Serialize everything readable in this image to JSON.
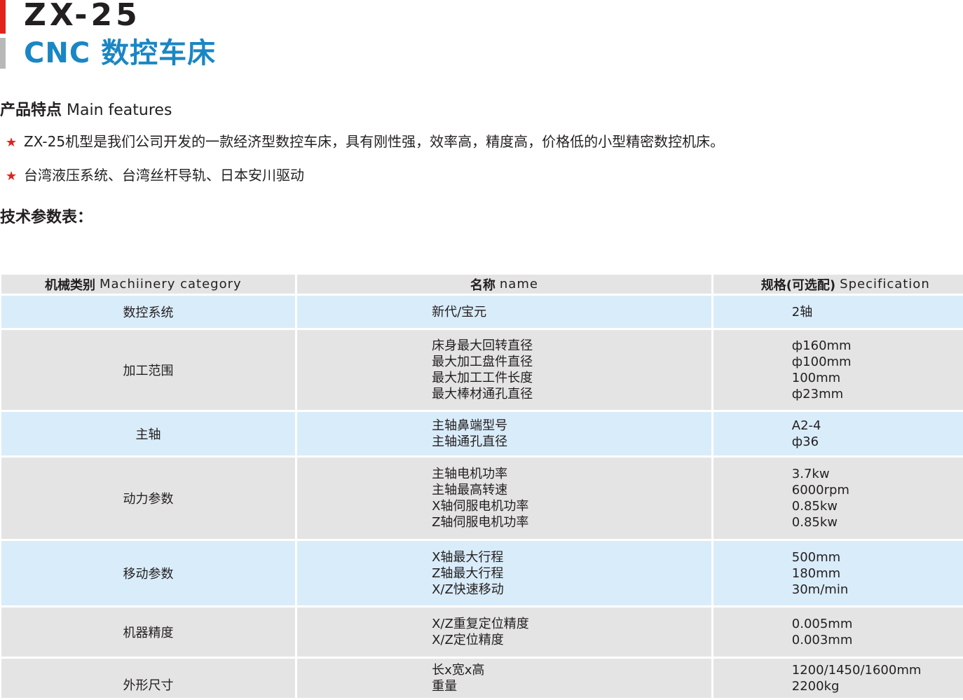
{
  "header": {
    "model": "ZX-25",
    "subtitle": "CNC 数控车床"
  },
  "features": {
    "title_zh": "产品特点",
    "title_en": "Main features",
    "items": [
      "ZX-25机型是我们公司开发的一款经济型数控车床，具有刚性强，效率高，精度高，价格低的小型精密数控机床。",
      "台湾液压系统、台湾丝杆导轨、日本安川驱动"
    ]
  },
  "params": {
    "title": "技术参数表：",
    "columns": [
      {
        "zh": "机械类别",
        "en": "Machiinery category"
      },
      {
        "zh": "名称",
        "en": "name"
      },
      {
        "zh": "规格(可选配)",
        "en": "Specification"
      }
    ],
    "rows": [
      {
        "category": "数控系统",
        "names": [
          "新代/宝元"
        ],
        "specs": [
          "2轴"
        ]
      },
      {
        "category": "加工范围",
        "names": [
          "床身最大回转直径",
          "最大加工盘件直径",
          "最大加工工件长度",
          "最大棒材通孔直径"
        ],
        "specs": [
          "ф160mm",
          "ф100mm",
          "100mm",
          "ф23mm"
        ]
      },
      {
        "category": "主轴",
        "names": [
          "主轴鼻端型号",
          "主轴通孔直径"
        ],
        "specs": [
          "A2-4",
          "ф36"
        ]
      },
      {
        "category": "动力参数",
        "names": [
          "主轴电机功率",
          "主轴最高转速",
          "X轴伺服电机功率",
          "Z轴伺服电机功率"
        ],
        "specs": [
          "3.7kw",
          "6000rpm",
          "0.85kw",
          "0.85kw"
        ]
      },
      {
        "category": "移动参数",
        "names": [
          "X轴最大行程",
          "Z轴最大行程",
          "X/Z快速移动"
        ],
        "specs": [
          "500mm",
          "180mm",
          "30m/min"
        ]
      },
      {
        "category": "机器精度",
        "names": [
          "X/Z重复定位精度",
          "X/Z定位精度"
        ],
        "specs": [
          "0.005mm",
          "0.003mm"
        ]
      },
      {
        "category": "外形尺寸",
        "names": [
          "长x宽x高",
          "重量"
        ],
        "specs": [
          "1200/1450/1600mm",
          "2200kg"
        ]
      }
    ]
  },
  "colors": {
    "accent_red": "#e2231a",
    "accent_blue": "#1a86c4",
    "row_gray": "#e4e4e4",
    "row_blue": "#d9ecfa"
  },
  "icons": {
    "bullet": "star-icon"
  }
}
